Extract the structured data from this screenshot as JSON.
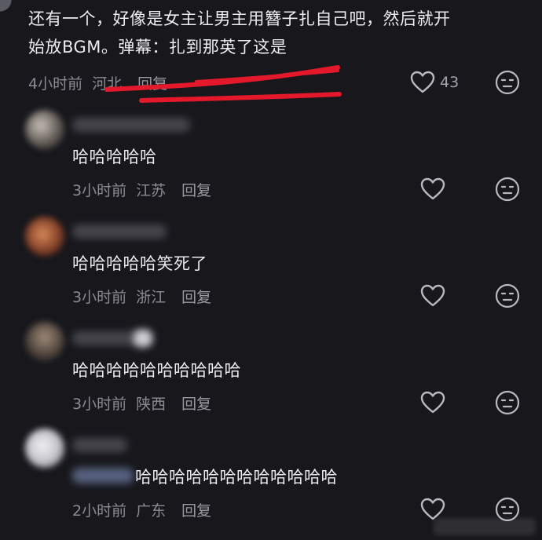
{
  "comments": [
    {
      "text_line1": "还有一个，好像是女主让男主用簪子扎自己吧，然后就开",
      "text_line2": "始放BGM。弹幕：扎到那英了这是",
      "time": "4小时前",
      "location": "河北",
      "reply": "回复",
      "likes": "43"
    },
    {
      "text": "哈哈哈哈哈",
      "time": "3小时前",
      "location": "江苏",
      "reply": "回复"
    },
    {
      "text": "哈哈哈哈哈笑死了",
      "time": "3小时前",
      "location": "浙江",
      "reply": "回复"
    },
    {
      "text": "哈哈哈哈哈哈哈哈哈哈",
      "time": "3小时前",
      "location": "陕西",
      "reply": "回复"
    },
    {
      "text": "哈哈哈哈哈哈哈哈哈哈哈哈",
      "time": "2小时前",
      "location": "广东",
      "reply": "回复"
    }
  ],
  "colors": {
    "background": "#17171c",
    "text": "#ececf1",
    "meta": "#8b8b94",
    "highlight_stroke": "#e3192b"
  },
  "icons": {
    "like": "heart-outline-icon",
    "reaction": "neutral-face-icon"
  }
}
